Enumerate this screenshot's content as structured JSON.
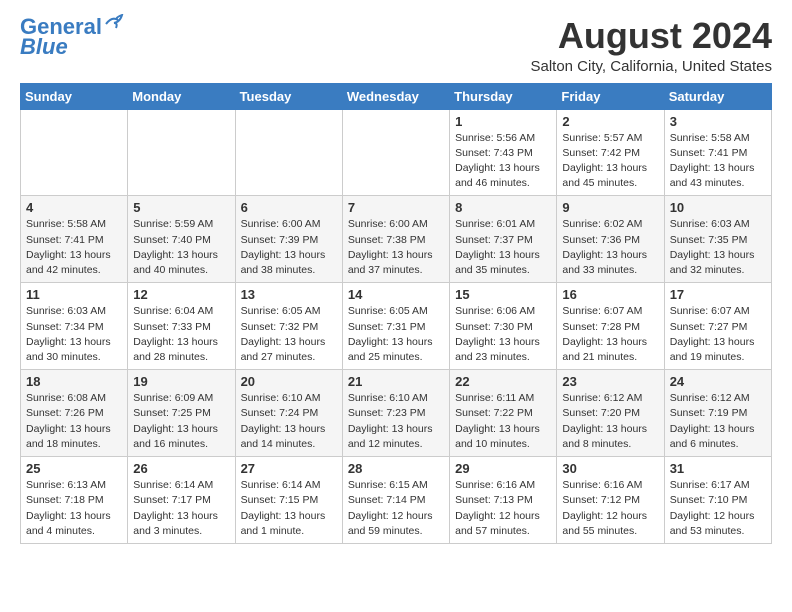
{
  "header": {
    "logo_line1": "General",
    "logo_line2": "Blue",
    "month_title": "August 2024",
    "subtitle": "Salton City, California, United States"
  },
  "days_of_week": [
    "Sunday",
    "Monday",
    "Tuesday",
    "Wednesday",
    "Thursday",
    "Friday",
    "Saturday"
  ],
  "weeks": [
    {
      "days": [
        {
          "num": "",
          "info": ""
        },
        {
          "num": "",
          "info": ""
        },
        {
          "num": "",
          "info": ""
        },
        {
          "num": "",
          "info": ""
        },
        {
          "num": "1",
          "info": "Sunrise: 5:56 AM\nSunset: 7:43 PM\nDaylight: 13 hours\nand 46 minutes."
        },
        {
          "num": "2",
          "info": "Sunrise: 5:57 AM\nSunset: 7:42 PM\nDaylight: 13 hours\nand 45 minutes."
        },
        {
          "num": "3",
          "info": "Sunrise: 5:58 AM\nSunset: 7:41 PM\nDaylight: 13 hours\nand 43 minutes."
        }
      ]
    },
    {
      "days": [
        {
          "num": "4",
          "info": "Sunrise: 5:58 AM\nSunset: 7:41 PM\nDaylight: 13 hours\nand 42 minutes."
        },
        {
          "num": "5",
          "info": "Sunrise: 5:59 AM\nSunset: 7:40 PM\nDaylight: 13 hours\nand 40 minutes."
        },
        {
          "num": "6",
          "info": "Sunrise: 6:00 AM\nSunset: 7:39 PM\nDaylight: 13 hours\nand 38 minutes."
        },
        {
          "num": "7",
          "info": "Sunrise: 6:00 AM\nSunset: 7:38 PM\nDaylight: 13 hours\nand 37 minutes."
        },
        {
          "num": "8",
          "info": "Sunrise: 6:01 AM\nSunset: 7:37 PM\nDaylight: 13 hours\nand 35 minutes."
        },
        {
          "num": "9",
          "info": "Sunrise: 6:02 AM\nSunset: 7:36 PM\nDaylight: 13 hours\nand 33 minutes."
        },
        {
          "num": "10",
          "info": "Sunrise: 6:03 AM\nSunset: 7:35 PM\nDaylight: 13 hours\nand 32 minutes."
        }
      ]
    },
    {
      "days": [
        {
          "num": "11",
          "info": "Sunrise: 6:03 AM\nSunset: 7:34 PM\nDaylight: 13 hours\nand 30 minutes."
        },
        {
          "num": "12",
          "info": "Sunrise: 6:04 AM\nSunset: 7:33 PM\nDaylight: 13 hours\nand 28 minutes."
        },
        {
          "num": "13",
          "info": "Sunrise: 6:05 AM\nSunset: 7:32 PM\nDaylight: 13 hours\nand 27 minutes."
        },
        {
          "num": "14",
          "info": "Sunrise: 6:05 AM\nSunset: 7:31 PM\nDaylight: 13 hours\nand 25 minutes."
        },
        {
          "num": "15",
          "info": "Sunrise: 6:06 AM\nSunset: 7:30 PM\nDaylight: 13 hours\nand 23 minutes."
        },
        {
          "num": "16",
          "info": "Sunrise: 6:07 AM\nSunset: 7:28 PM\nDaylight: 13 hours\nand 21 minutes."
        },
        {
          "num": "17",
          "info": "Sunrise: 6:07 AM\nSunset: 7:27 PM\nDaylight: 13 hours\nand 19 minutes."
        }
      ]
    },
    {
      "days": [
        {
          "num": "18",
          "info": "Sunrise: 6:08 AM\nSunset: 7:26 PM\nDaylight: 13 hours\nand 18 minutes."
        },
        {
          "num": "19",
          "info": "Sunrise: 6:09 AM\nSunset: 7:25 PM\nDaylight: 13 hours\nand 16 minutes."
        },
        {
          "num": "20",
          "info": "Sunrise: 6:10 AM\nSunset: 7:24 PM\nDaylight: 13 hours\nand 14 minutes."
        },
        {
          "num": "21",
          "info": "Sunrise: 6:10 AM\nSunset: 7:23 PM\nDaylight: 13 hours\nand 12 minutes."
        },
        {
          "num": "22",
          "info": "Sunrise: 6:11 AM\nSunset: 7:22 PM\nDaylight: 13 hours\nand 10 minutes."
        },
        {
          "num": "23",
          "info": "Sunrise: 6:12 AM\nSunset: 7:20 PM\nDaylight: 13 hours\nand 8 minutes."
        },
        {
          "num": "24",
          "info": "Sunrise: 6:12 AM\nSunset: 7:19 PM\nDaylight: 13 hours\nand 6 minutes."
        }
      ]
    },
    {
      "days": [
        {
          "num": "25",
          "info": "Sunrise: 6:13 AM\nSunset: 7:18 PM\nDaylight: 13 hours\nand 4 minutes."
        },
        {
          "num": "26",
          "info": "Sunrise: 6:14 AM\nSunset: 7:17 PM\nDaylight: 13 hours\nand 3 minutes."
        },
        {
          "num": "27",
          "info": "Sunrise: 6:14 AM\nSunset: 7:15 PM\nDaylight: 13 hours\nand 1 minute."
        },
        {
          "num": "28",
          "info": "Sunrise: 6:15 AM\nSunset: 7:14 PM\nDaylight: 12 hours\nand 59 minutes."
        },
        {
          "num": "29",
          "info": "Sunrise: 6:16 AM\nSunset: 7:13 PM\nDaylight: 12 hours\nand 57 minutes."
        },
        {
          "num": "30",
          "info": "Sunrise: 6:16 AM\nSunset: 7:12 PM\nDaylight: 12 hours\nand 55 minutes."
        },
        {
          "num": "31",
          "info": "Sunrise: 6:17 AM\nSunset: 7:10 PM\nDaylight: 12 hours\nand 53 minutes."
        }
      ]
    }
  ]
}
